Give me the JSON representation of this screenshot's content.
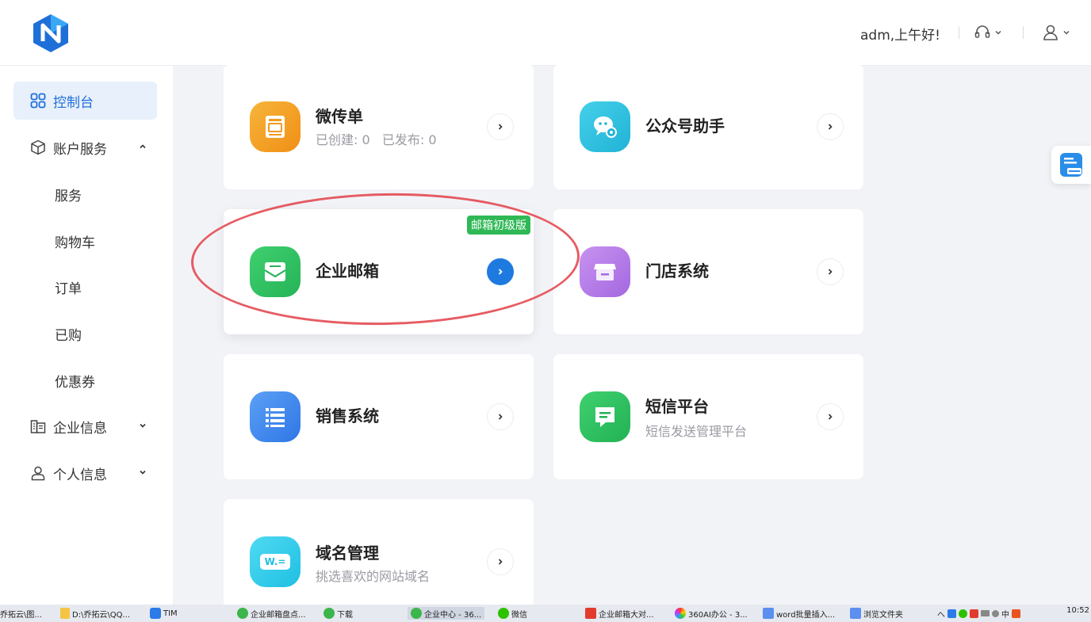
{
  "header": {
    "greeting": "adm,上午好!"
  },
  "sidebar": {
    "items": [
      {
        "label": "控制台",
        "icon": "grid-icon",
        "active": true
      },
      {
        "label": "账户服务",
        "icon": "cube-icon",
        "expanded": true
      },
      {
        "label": "服务"
      },
      {
        "label": "购物车"
      },
      {
        "label": "订单"
      },
      {
        "label": "已购"
      },
      {
        "label": "优惠券"
      },
      {
        "label": "企业信息",
        "icon": "building-icon"
      },
      {
        "label": "个人信息",
        "icon": "user-icon"
      }
    ]
  },
  "cards": [
    {
      "title": "微传单",
      "subtitle": "已创建: 0   已发布: 0",
      "icon": "flyer-icon",
      "color": "#f39a1e"
    },
    {
      "title": "公众号助手",
      "subtitle": "",
      "icon": "wechat-official-icon",
      "color": "#2bbcd9"
    },
    {
      "title": "企业邮箱",
      "subtitle": "",
      "icon": "mail-icon",
      "color": "#2fbf5f",
      "badge": "邮箱初级版"
    },
    {
      "title": "门店系统",
      "subtitle": "",
      "icon": "store-icon",
      "color": "#b47ce8"
    },
    {
      "title": "销售系统",
      "subtitle": "",
      "icon": "list-icon",
      "color": "#3c86ef"
    },
    {
      "title": "短信平台",
      "subtitle": "短信发送管理平台",
      "icon": "sms-icon",
      "color": "#2dbf62"
    },
    {
      "title": "域名管理",
      "subtitle": "挑选喜欢的网站域名",
      "icon": "domain-icon",
      "color": "#2bc8e8",
      "icon_text": "W.="
    }
  ],
  "taskbar": {
    "items": [
      "乔拓云\\图...",
      "D:\\乔拓云\\QQ...",
      "TIM",
      "企业邮箱盘点...",
      "下载",
      "企业中心 - 36...",
      "微信",
      "企业邮箱大对...",
      "360AI办公 - 3...",
      "word批量插入...",
      "浏览文件夹"
    ],
    "tray": "へ",
    "ime": "中",
    "clock": "10:52"
  }
}
